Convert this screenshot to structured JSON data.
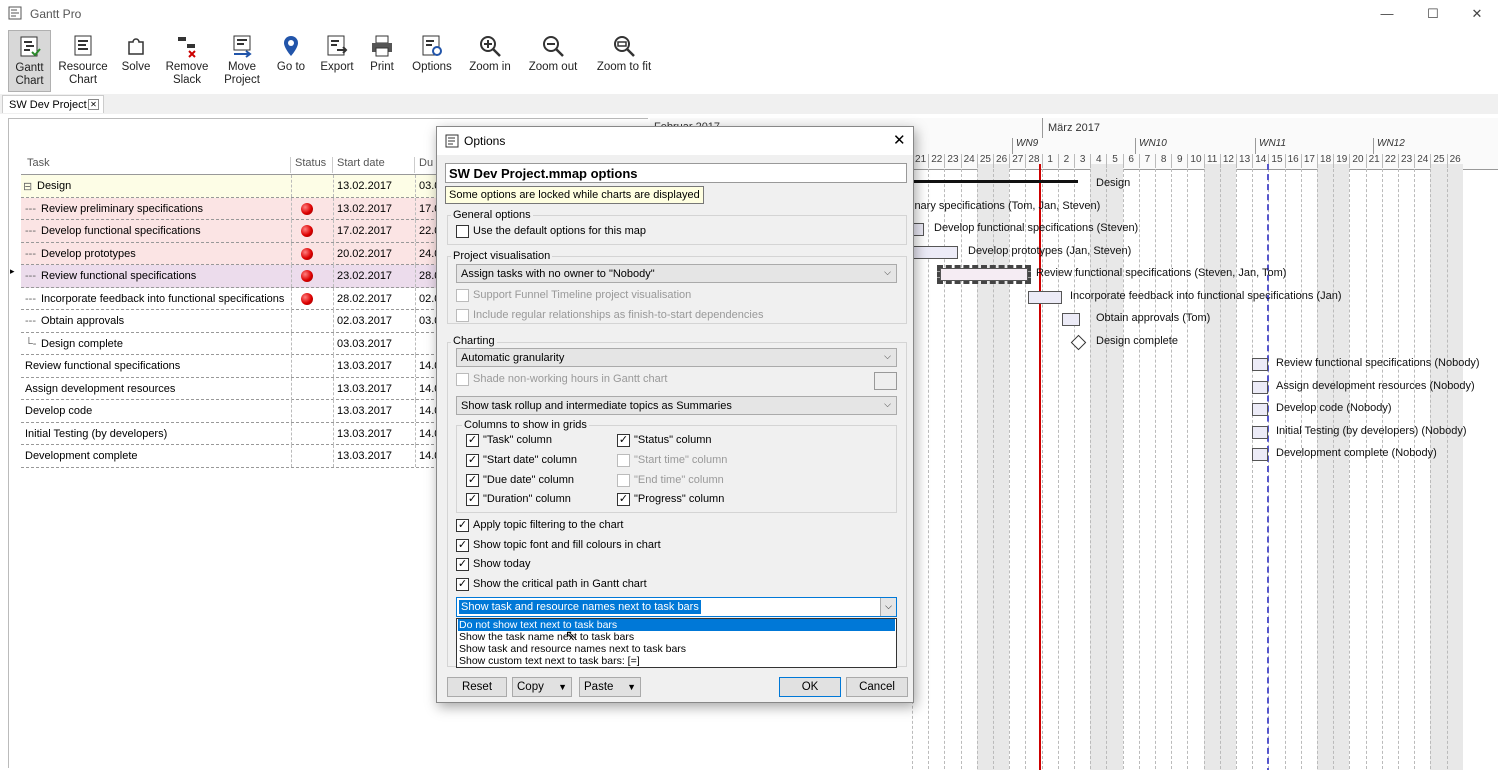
{
  "app": {
    "title": "Gantt Pro",
    "doc_tab": "SW Dev Project"
  },
  "toolbar": [
    {
      "id": "gantt",
      "line1": "Gantt",
      "line2": "Chart"
    },
    {
      "id": "resource",
      "line1": "Resource",
      "line2": "Chart"
    },
    {
      "id": "solve",
      "line1": "Solve",
      "line2": ""
    },
    {
      "id": "remove-slack",
      "line1": "Remove",
      "line2": "Slack"
    },
    {
      "id": "move-project",
      "line1": "Move",
      "line2": "Project"
    },
    {
      "id": "goto",
      "line1": "Go to",
      "line2": ""
    },
    {
      "id": "export",
      "line1": "Export",
      "line2": ""
    },
    {
      "id": "print",
      "line1": "Print",
      "line2": ""
    },
    {
      "id": "options",
      "line1": "Options",
      "line2": ""
    },
    {
      "id": "zoom-in",
      "line1": "Zoom in",
      "line2": ""
    },
    {
      "id": "zoom-out",
      "line1": "Zoom out",
      "line2": ""
    },
    {
      "id": "zoom-fit",
      "line1": "Zoom to fit",
      "line2": ""
    }
  ],
  "grid": {
    "headers": {
      "task": "Task",
      "status": "Status",
      "start": "Start date",
      "due": "Du"
    },
    "rows": [
      {
        "task": "Design",
        "start": "13.02.2017",
        "due": "03.0",
        "prefix": "⊟ ",
        "status": false,
        "bg": "#fdfde6"
      },
      {
        "task": "Review preliminary specifications",
        "start": "13.02.2017",
        "due": "17.0",
        "prefix": "--- ",
        "status": true,
        "bg": "#fbe4e4"
      },
      {
        "task": "Develop functional specifications",
        "start": "17.02.2017",
        "due": "22.0",
        "prefix": "--- ",
        "status": true,
        "bg": "#fbe4e4"
      },
      {
        "task": "Develop prototypes",
        "start": "20.02.2017",
        "due": "24.0",
        "prefix": "--- ",
        "status": true,
        "bg": "#fbe4e4"
      },
      {
        "task": "Review functional specifications",
        "start": "23.02.2017",
        "due": "28.0",
        "prefix": "--- ",
        "status": true,
        "bg": "#ecdcec"
      },
      {
        "task": "Incorporate feedback into functional specifications",
        "start": "28.02.2017",
        "due": "02.0",
        "prefix": "--- ",
        "status": true,
        "bg": "#ffffff"
      },
      {
        "task": "Obtain approvals",
        "start": "02.03.2017",
        "due": "03.0",
        "prefix": "--- ",
        "status": false,
        "bg": "#ffffff"
      },
      {
        "task": "Design complete",
        "start": "03.03.2017",
        "due": "",
        "prefix": "└- ",
        "status": false,
        "bg": "#ffffff"
      },
      {
        "task": "Review functional specifications",
        "start": "13.03.2017",
        "due": "14.0",
        "prefix": "",
        "status": false,
        "bg": "#ffffff"
      },
      {
        "task": "Assign development resources",
        "start": "13.03.2017",
        "due": "14.0",
        "prefix": "",
        "status": false,
        "bg": "#ffffff"
      },
      {
        "task": "Develop code",
        "start": "13.03.2017",
        "due": "14.0",
        "prefix": "",
        "status": false,
        "bg": "#ffffff"
      },
      {
        "task": "Initial Testing (by developers)",
        "start": "13.03.2017",
        "due": "14.0",
        "prefix": "",
        "status": false,
        "bg": "#ffffff"
      },
      {
        "task": "Development complete",
        "start": "13.03.2017",
        "due": "14.0",
        "prefix": "",
        "status": false,
        "bg": "#ffffff"
      }
    ]
  },
  "chart": {
    "month1": "Februar 2017",
    "month2": "März 2017",
    "weeks": [
      "WN9",
      "WN10",
      "WN11",
      "WN12"
    ],
    "days": [
      "21",
      "22",
      "23",
      "24",
      "25",
      "26",
      "27",
      "28",
      "1",
      "2",
      "3",
      "4",
      "5",
      "6",
      "7",
      "8",
      "9",
      "10",
      "11",
      "12",
      "13",
      "14",
      "15",
      "16",
      "17",
      "18",
      "19",
      "20",
      "21",
      "22",
      "23",
      "24",
      "25",
      "26"
    ],
    "labels": [
      "Design",
      "inary specifications (Tom, Jan, Steven)",
      "Develop functional specifications (Steven)",
      "Develop prototypes (Jan, Steven)",
      "Review functional specifications (Steven, Jan, Tom)",
      "Incorporate feedback into functional specifications (Jan)",
      "Obtain approvals (Tom)",
      "Design complete",
      "Review functional specifications (Nobody)",
      "Assign development resources (Nobody)",
      "Develop code (Nobody)",
      "Initial Testing (by developers) (Nobody)",
      "Development complete (Nobody)"
    ]
  },
  "dialog": {
    "title": "Options",
    "heading": "SW Dev Project.mmap options",
    "locked_note": "Some options are locked while charts are displayed",
    "general": {
      "label": "General options",
      "use_default": "Use the default options for this map"
    },
    "visual": {
      "label": "Project visualisation",
      "assign_combo": "Assign tasks with no owner to \"Nobody\"",
      "funnel": "Support Funnel Timeline project visualisation",
      "regular": "Include regular relationships as finish-to-start dependencies"
    },
    "charting": {
      "label": "Charting",
      "granularity": "Automatic granularity",
      "shade": "Shade non-working hours in Gantt chart",
      "rollup": "Show task rollup and intermediate topics as Summaries",
      "columns_label": "Columns to show in grids",
      "cols_left": [
        {
          "label": "\"Task\" column",
          "checked": true
        },
        {
          "label": "\"Start date\" column",
          "checked": true
        },
        {
          "label": "\"Due date\" column",
          "checked": true
        },
        {
          "label": "\"Duration\" column",
          "checked": true
        }
      ],
      "cols_right": [
        {
          "label": "\"Status\" column",
          "checked": true,
          "disabled": false
        },
        {
          "label": "\"Start time\" column",
          "checked": false,
          "disabled": true
        },
        {
          "label": "\"End time\" column",
          "checked": false,
          "disabled": true
        },
        {
          "label": "\"Progress\" column",
          "checked": true,
          "disabled": false
        }
      ],
      "opts": [
        {
          "label": "Apply topic filtering to the chart",
          "checked": true
        },
        {
          "label": "Show topic font and fill colours in chart",
          "checked": true
        },
        {
          "label": "Show today",
          "checked": true
        },
        {
          "label": "Show the critical path in Gantt chart",
          "checked": true
        }
      ],
      "text_combo": "Show task and resource names next to task bars",
      "dropdown_options": [
        "Do not show text next to task bars",
        "Show the task name next to task bars",
        "Show task and resource names next to task bars",
        "Show custom text next to task bars: [=]"
      ]
    },
    "buttons": {
      "reset": "Reset",
      "copy": "Copy",
      "paste": "Paste",
      "ok": "OK",
      "cancel": "Cancel"
    }
  },
  "colors": {
    "accent": "#0078d7",
    "critical": "#cc0000",
    "today": "#4444cc"
  }
}
